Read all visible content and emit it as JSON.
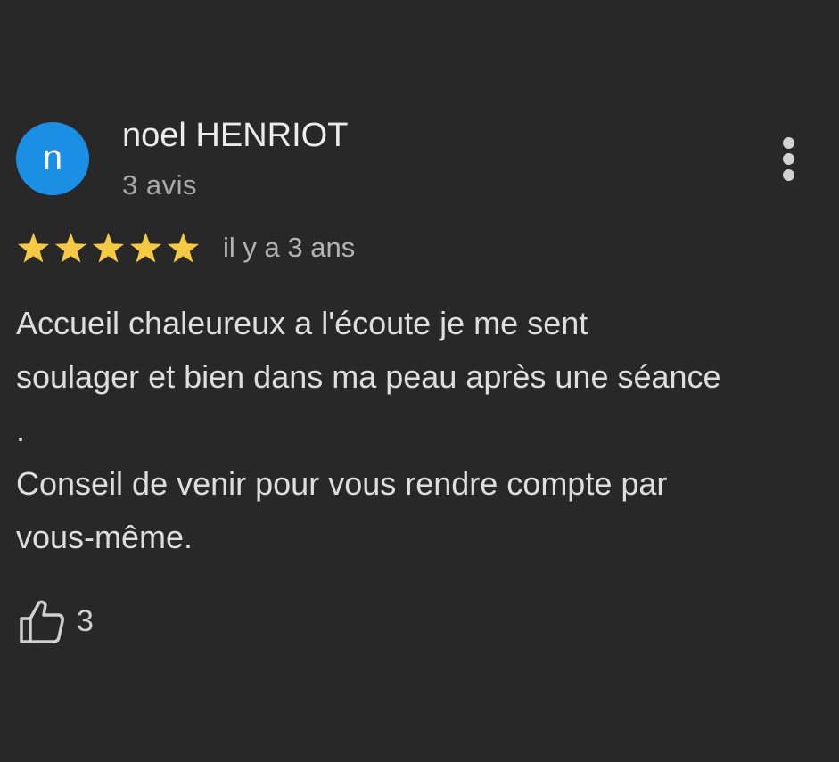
{
  "author": {
    "initial": "n",
    "name": "noel HENRIOT",
    "review_count": "3 avis",
    "avatar_color": "#1a8fe3"
  },
  "menu": {
    "icon": "more-vertical-icon"
  },
  "review": {
    "rating": 5,
    "rating_max": 5,
    "star_color": "#f6c944",
    "date": "il y a 3 ans",
    "text": "Accueil chaleureux a l'écoute je me sent\nsoulager et bien dans ma peau après une séance\n.\nConseil de venir pour vous rendre compte par\nvous-même."
  },
  "actions": {
    "like_icon": "thumbs-up-icon",
    "like_count": "3"
  }
}
